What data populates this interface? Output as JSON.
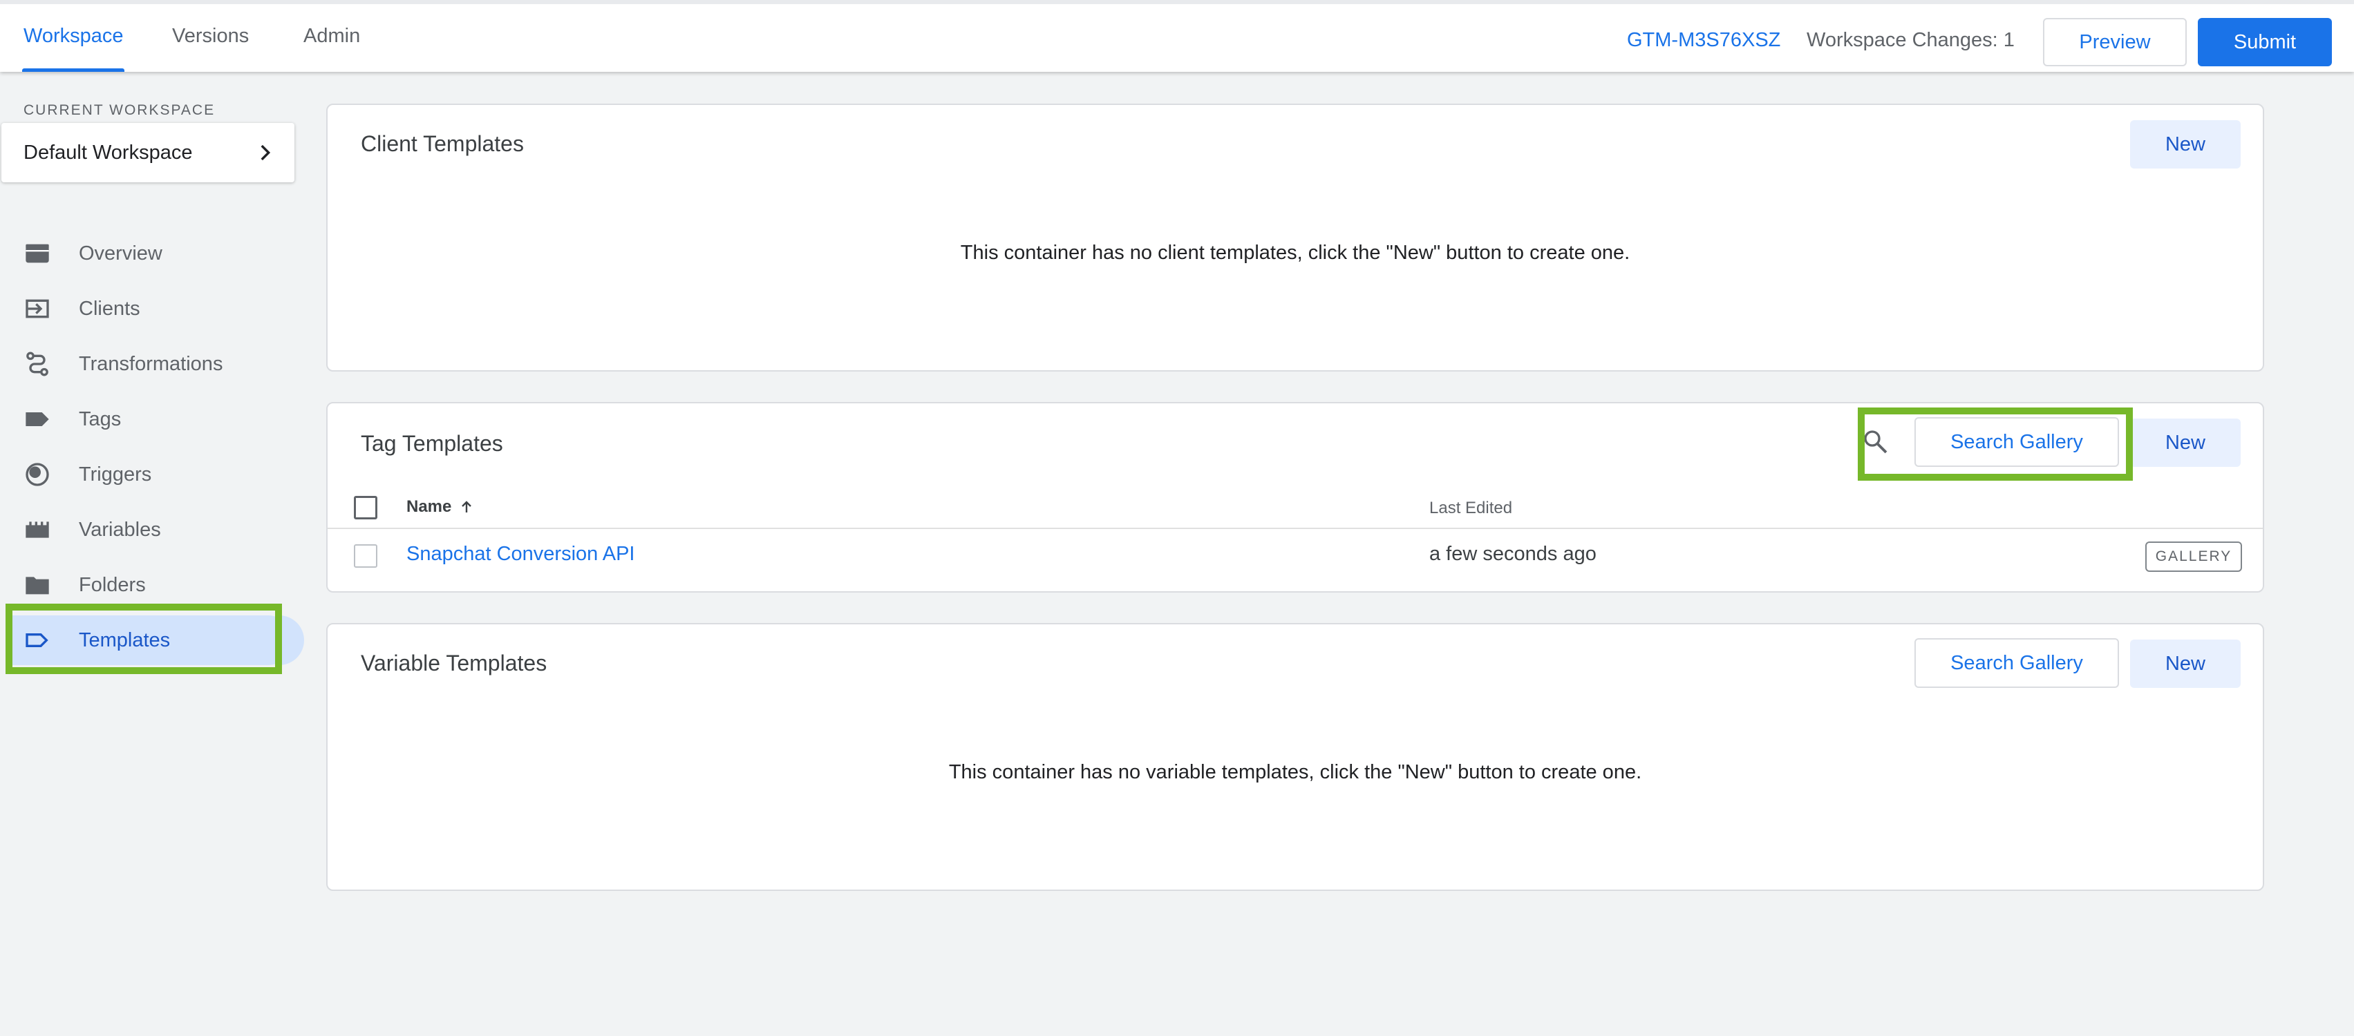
{
  "topbar": {
    "tabs": [
      {
        "label": "Workspace",
        "active": true
      },
      {
        "label": "Versions",
        "active": false
      },
      {
        "label": "Admin",
        "active": false
      }
    ],
    "container_id": "GTM-M3S76XSZ",
    "workspace_changes": "Workspace Changes: 1",
    "preview_label": "Preview",
    "submit_label": "Submit"
  },
  "sidebar": {
    "current_workspace_label": "CURRENT WORKSPACE",
    "workspace_name": "Default Workspace",
    "items": [
      {
        "label": "Overview",
        "icon": "briefcase-icon"
      },
      {
        "label": "Clients",
        "icon": "client-icon"
      },
      {
        "label": "Transformations",
        "icon": "transformation-icon"
      },
      {
        "label": "Tags",
        "icon": "tag-icon"
      },
      {
        "label": "Triggers",
        "icon": "trigger-icon"
      },
      {
        "label": "Variables",
        "icon": "variable-icon"
      },
      {
        "label": "Folders",
        "icon": "folder-icon"
      },
      {
        "label": "Templates",
        "icon": "template-icon",
        "active": true
      }
    ]
  },
  "client_templates": {
    "title": "Client Templates",
    "new_label": "New",
    "empty_message": "This container has no client templates, click the \"New\" button to create one."
  },
  "tag_templates": {
    "title": "Tag Templates",
    "search_gallery_label": "Search Gallery",
    "new_label": "New",
    "columns": {
      "name": "Name",
      "last_edited": "Last Edited"
    },
    "rows": [
      {
        "name": "Snapchat Conversion API",
        "last_edited": "a few seconds ago",
        "badge": "GALLERY"
      }
    ]
  },
  "variable_templates": {
    "title": "Variable Templates",
    "search_gallery_label": "Search Gallery",
    "new_label": "New",
    "empty_message": "This container has no variable templates, click the \"New\" button to create one."
  },
  "colors": {
    "accent": "#1a73e8",
    "highlight": "#76b82a",
    "active_nav_bg": "#d2e3fc",
    "page_bg": "#f1f3f4"
  }
}
